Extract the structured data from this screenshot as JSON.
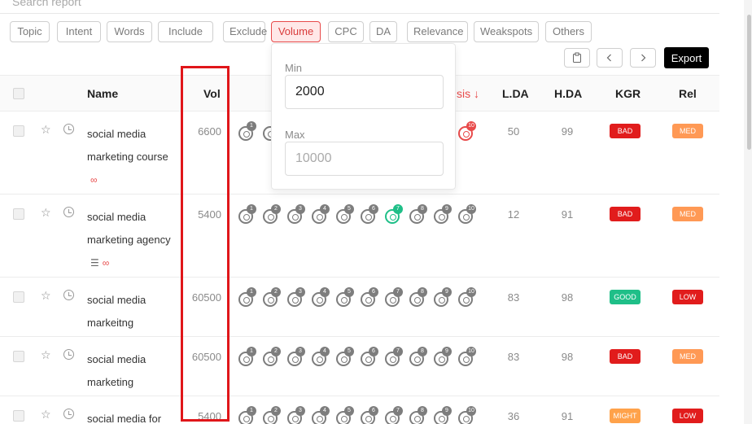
{
  "search": {
    "placeholder": "Search report"
  },
  "filters": [
    "Topic",
    "Intent",
    "Words",
    "Include",
    "Exclude",
    "Volume",
    "CPC",
    "DA",
    "Relevance",
    "Weakspots",
    "Others"
  ],
  "active_filter": "Volume",
  "toolbar": {
    "export_label": "Export",
    "prev_icon": "chevron-left-icon",
    "next_icon": "chevron-right-icon",
    "clipboard_icon": "clipboard-icon"
  },
  "volume_popup": {
    "min_label": "Min",
    "min_value": "2000",
    "max_label": "Max",
    "max_placeholder": "10000"
  },
  "table": {
    "headers": {
      "name": "Name",
      "vol": "Vol",
      "sort": "sis ↓",
      "lda": "L.DA",
      "hda": "H.DA",
      "kgr": "KGR",
      "rel": "Rel"
    },
    "rows": [
      {
        "keyword_lines": [
          "social media",
          "marketing course"
        ],
        "vol": "6600",
        "serp_green": null,
        "serp_red": 10,
        "lda": "50",
        "hda": "99",
        "kgr": "BAD",
        "rel": "MED"
      },
      {
        "keyword_lines": [
          "social media",
          "marketing agency"
        ],
        "vol": "5400",
        "serp_green": 7,
        "serp_red": null,
        "lda": "12",
        "hda": "91",
        "kgr": "BAD",
        "rel": "MED"
      },
      {
        "keyword_lines": [
          "social media",
          "markeitng"
        ],
        "vol": "60500",
        "serp_green": null,
        "serp_red": null,
        "lda": "83",
        "hda": "98",
        "kgr": "GOOD",
        "rel": "LOW"
      },
      {
        "keyword_lines": [
          "social media",
          "marketing"
        ],
        "vol": "60500",
        "serp_green": null,
        "serp_red": null,
        "lda": "83",
        "hda": "98",
        "kgr": "BAD",
        "rel": "MED"
      },
      {
        "keyword_lines": [
          "social media for"
        ],
        "vol": "5400",
        "serp_green": null,
        "serp_red": null,
        "lda": "36",
        "hda": "91",
        "kgr": "MIGHT",
        "rel": "LOW"
      }
    ]
  },
  "colors": {
    "accent": "#e84a4a",
    "good": "#1fbf88",
    "bad": "#e11c1c",
    "med": "#ff9955",
    "might": "#ffa24a",
    "low": "#e11c1c",
    "highlight": "#e0161a"
  }
}
